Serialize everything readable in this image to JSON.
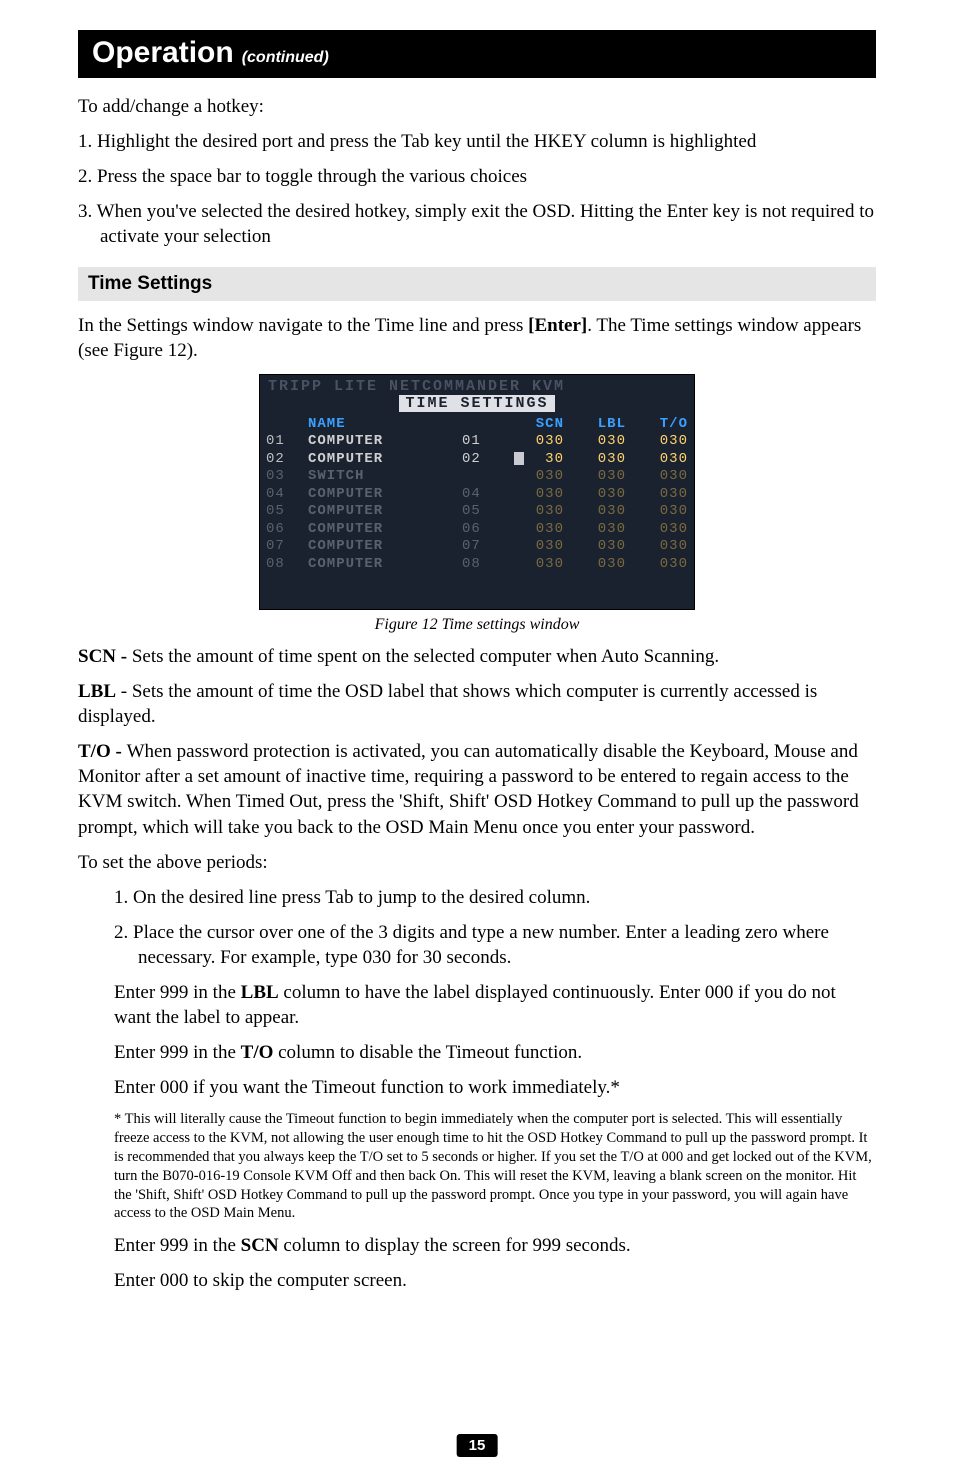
{
  "header": {
    "title": "Operation",
    "continued": "(continued)"
  },
  "intro": "To add/change a hotkey:",
  "steps": [
    "1. Highlight the desired port and press the Tab key until the HKEY column is highlighted",
    "2. Press the space bar to toggle through the various choices",
    "3. When you've selected the desired hotkey, simply exit the OSD. Hitting the Enter key is not required to activate your selection"
  ],
  "subhead": "Time Settings",
  "settings_para_a": "In the Settings window navigate to the Time line and press ",
  "settings_enter": "[Enter]",
  "settings_para_b": ". The Time settings window appears (see Figure 12).",
  "osd": {
    "brand": "TRIPP LITE NETCOMMANDER KVM",
    "title": "TIME SETTINGS",
    "cols": {
      "name": "NAME",
      "scn": "SCN",
      "lbl": "LBL",
      "to": "T/O"
    },
    "rows": [
      {
        "idx": "01",
        "name": "COMPUTER",
        "pn": "01",
        "scn": "030",
        "lbl": "030",
        "to": "030",
        "bright": true
      },
      {
        "idx": "02",
        "name": "COMPUTER",
        "pn": "02",
        "scn": "∎30",
        "lbl": "030",
        "to": "030",
        "bright": true,
        "cursor": true
      },
      {
        "idx": "03",
        "name": "SWITCH",
        "pn": "",
        "scn": "030",
        "lbl": "030",
        "to": "030",
        "bright": false
      },
      {
        "idx": "04",
        "name": "COMPUTER",
        "pn": "04",
        "scn": "030",
        "lbl": "030",
        "to": "030",
        "bright": false
      },
      {
        "idx": "05",
        "name": "COMPUTER",
        "pn": "05",
        "scn": "030",
        "lbl": "030",
        "to": "030",
        "bright": false
      },
      {
        "idx": "06",
        "name": "COMPUTER",
        "pn": "06",
        "scn": "030",
        "lbl": "030",
        "to": "030",
        "bright": false
      },
      {
        "idx": "07",
        "name": "COMPUTER",
        "pn": "07",
        "scn": "030",
        "lbl": "030",
        "to": "030",
        "bright": false
      },
      {
        "idx": "08",
        "name": "COMPUTER",
        "pn": "08",
        "scn": "030",
        "lbl": "030",
        "to": "030",
        "bright": false
      }
    ]
  },
  "fig_caption": "Figure 12 Time settings window",
  "scn_label": "SCN - ",
  "scn_text": "Sets the amount of time spent on the selected computer when Auto Scanning.",
  "lbl_label": "LBL",
  "lbl_text": " - Sets the amount of time the OSD label that shows which computer is currently accessed is displayed.",
  "to_label": "T/O - ",
  "to_text": "When password protection is activated, you can automatically disable the Keyboard, Mouse and Monitor after a set amount of inactive time, requiring a password to be entered to regain access to the KVM switch. When Timed Out, press the 'Shift, Shift' OSD Hotkey Command to pull up the password prompt, which will take you back to the OSD Main Menu once you enter your password.",
  "periods_intro": "To set the above periods:",
  "periods": {
    "p1": "1. On the desired line press Tab to jump to the desired column.",
    "p2": "2. Place the cursor over one of the 3 digits and type a new number. Enter a leading zero where necessary. For example, type 030 for 30 seconds.",
    "lbl_a": "Enter 999 in the ",
    "lbl_bold": "LBL",
    "lbl_b": " column to have the label displayed continuously. Enter 000 if you do not want the label to appear.",
    "to_a": "Enter 999 in the ",
    "to_bold": "T/O",
    "to_b": " column to disable the Timeout function.",
    "to_zero": "Enter 000 if you want the Timeout function to work immediately.*",
    "footnote": "* This will literally cause the Timeout function to begin immediately when the computer port is selected. This will essentially freeze access to the KVM, not allowing the user enough time to hit the OSD Hotkey Command to pull up the password prompt. It is recommended that you always keep the T/O set to 5 seconds or higher. If you set the T/O at 000 and get locked out of the KVM, turn the B070-016-19 Console KVM Off and then back On. This will reset the KVM, leaving a blank screen on the monitor. Hit the 'Shift, Shift' OSD Hotkey Command to pull up the password prompt. Once you type in your password, you will again have access to the OSD Main Menu.",
    "scn_a": "Enter 999 in the ",
    "scn_bold": "SCN",
    "scn_b": " column to display the screen for 999 seconds.",
    "scn_zero": "Enter 000 to skip the computer screen."
  },
  "page_number": "15"
}
